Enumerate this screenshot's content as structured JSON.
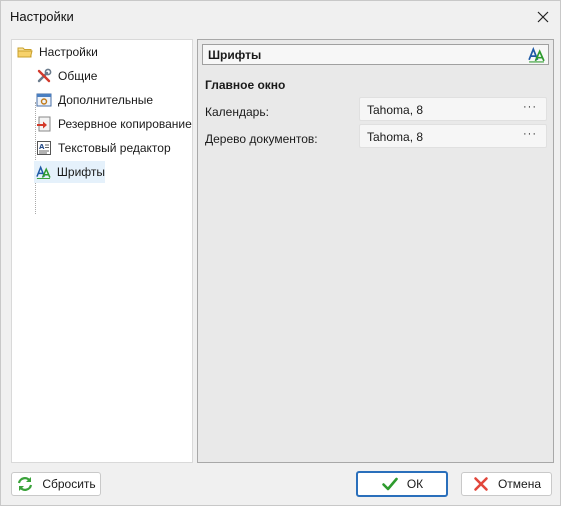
{
  "window": {
    "title": "Настройки"
  },
  "tree": {
    "items": [
      {
        "label": "Настройки",
        "icon": "folder-icon"
      },
      {
        "label": "Общие",
        "icon": "tools-icon"
      },
      {
        "label": "Дополнительные",
        "icon": "settings-window-icon"
      },
      {
        "label": "Резервное копирование",
        "icon": "backup-icon"
      },
      {
        "label": "Текстовый редактор",
        "icon": "text-document-icon"
      },
      {
        "label": "Шрифты",
        "icon": "fonts-icon",
        "selected": true
      }
    ]
  },
  "panel": {
    "header": "Шрифты",
    "group": "Главное окно",
    "fields": [
      {
        "label": "Календарь:",
        "value": "Tahoma, 8",
        "button": "···"
      },
      {
        "label": "Дерево документов:",
        "value": "Tahoma, 8",
        "button": "···"
      }
    ]
  },
  "buttons": {
    "reset": "Сбросить",
    "ok": "ОК",
    "cancel": "Отмена"
  },
  "colors": {
    "selection": "#e5f1fb",
    "ok_border": "#2a6fbb",
    "ok_check": "#2e9b2e",
    "cancel_x": "#e2463b",
    "reset_arrows": "#3aa23a"
  }
}
